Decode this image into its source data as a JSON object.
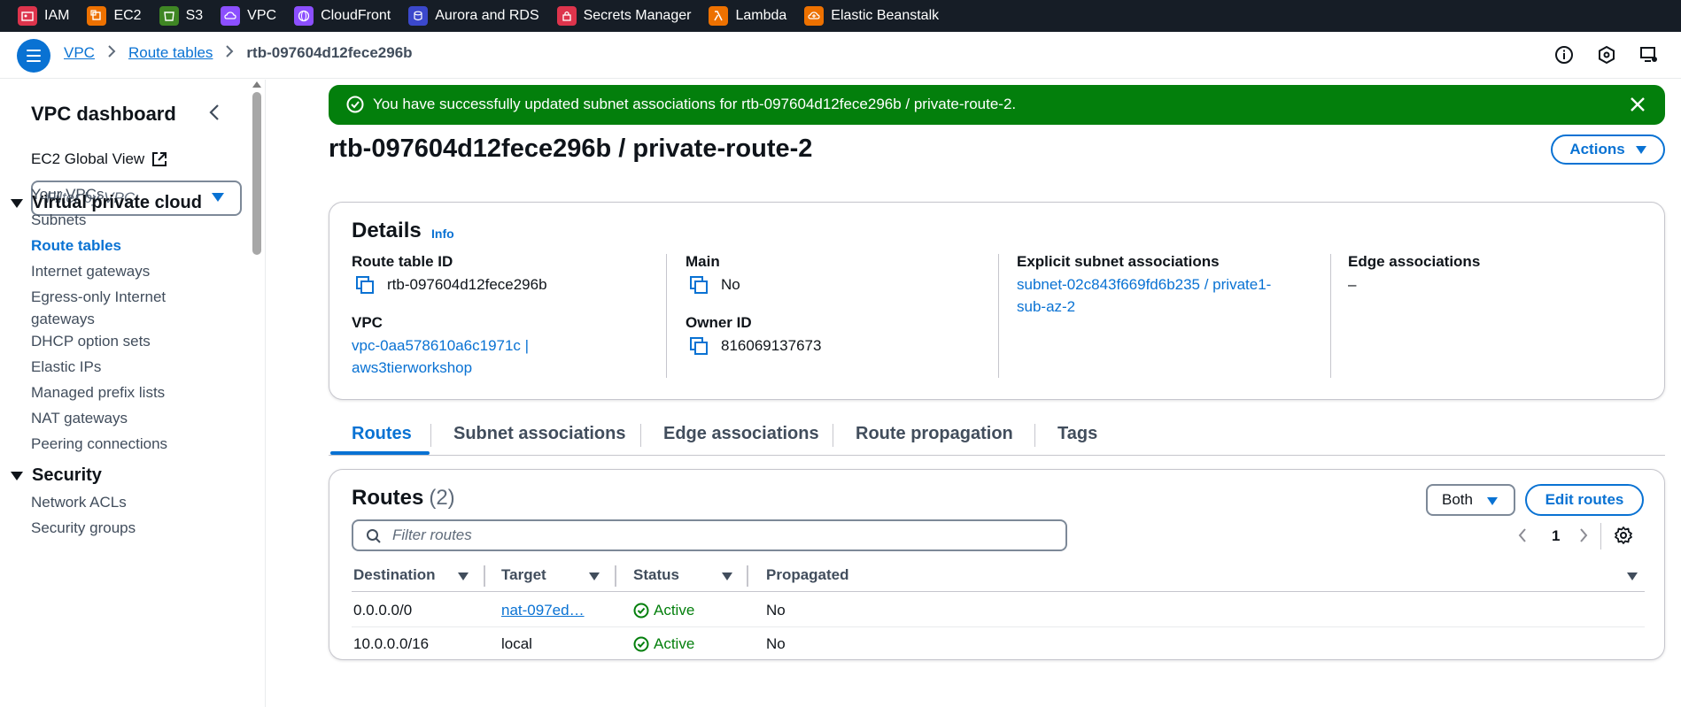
{
  "services": [
    {
      "label": "IAM",
      "icon": "iam-icon",
      "color": "#dd344c"
    },
    {
      "label": "EC2",
      "icon": "ec2-icon",
      "color": "#ed7100"
    },
    {
      "label": "S3",
      "icon": "s3-icon",
      "color": "#3f8624"
    },
    {
      "label": "VPC",
      "icon": "vpc-icon",
      "color": "#8c4fff"
    },
    {
      "label": "CloudFront",
      "icon": "cloudfront-icon",
      "color": "#8c4fff"
    },
    {
      "label": "Aurora and RDS",
      "icon": "rds-icon",
      "color": "#3b48cc"
    },
    {
      "label": "Secrets Manager",
      "icon": "secrets-manager-icon",
      "color": "#dd344c"
    },
    {
      "label": "Lambda",
      "icon": "lambda-icon",
      "color": "#ed7100"
    },
    {
      "label": "Elastic Beanstalk",
      "icon": "beanstalk-icon",
      "color": "#ed7100"
    }
  ],
  "breadcrumb": {
    "items": [
      "VPC",
      "Route tables"
    ],
    "current": "rtb-097604d12fece296b"
  },
  "sidebar": {
    "title": "VPC dashboard",
    "global_view": "EC2 Global View",
    "filter_placeholder": "Filter by VPC:",
    "sections": [
      {
        "label": "Virtual private cloud"
      },
      {
        "label": "Security"
      }
    ],
    "items": [
      "Your VPCs",
      "Subnets",
      "Route tables",
      "Internet gateways",
      "Egress-only Internet gateways",
      "DHCP option sets",
      "Elastic IPs",
      "Managed prefix lists",
      "NAT gateways",
      "Peering connections",
      "Network ACLs",
      "Security groups"
    ]
  },
  "flash": {
    "message": "You have successfully updated subnet associations for rtb-097604d12fece296b / private-route-2."
  },
  "page": {
    "title": "rtb-097604d12fece296b / private-route-2",
    "actions_label": "Actions"
  },
  "details": {
    "heading": "Details",
    "info": "Info",
    "route_table_id_label": "Route table ID",
    "route_table_id": "rtb-097604d12fece296b",
    "vpc_label": "VPC",
    "vpc_line1": "vpc-0aa578610a6c1971c |",
    "vpc_line2": "aws3tierworkshop",
    "main_label": "Main",
    "main_value": "No",
    "owner_label": "Owner ID",
    "owner_value": "816069137673",
    "explicit_label": "Explicit subnet associations",
    "explicit_line1": "subnet-02c843f669fd6b235 / private1-",
    "explicit_line2": "sub-az-2",
    "edge_label": "Edge associations",
    "edge_value": "–"
  },
  "tabs": [
    "Routes",
    "Subnet associations",
    "Edge associations",
    "Route propagation",
    "Tags"
  ],
  "routes": {
    "heading": "Routes",
    "count": "(2)",
    "filter_value": "Both",
    "edit_label": "Edit routes",
    "search_placeholder": "Filter routes",
    "page": "1",
    "columns": [
      "Destination",
      "Target",
      "Status",
      "Propagated"
    ],
    "rows": [
      {
        "destination": "0.0.0.0/0",
        "target": "nat-097ed…",
        "status": "Active",
        "propagated": "No"
      },
      {
        "destination": "10.0.0.0/16",
        "target": "local",
        "status": "Active",
        "propagated": "No"
      }
    ]
  },
  "colors": {
    "accent": "#0972d3",
    "success": "#037f0c",
    "topbar": "#161d26"
  }
}
